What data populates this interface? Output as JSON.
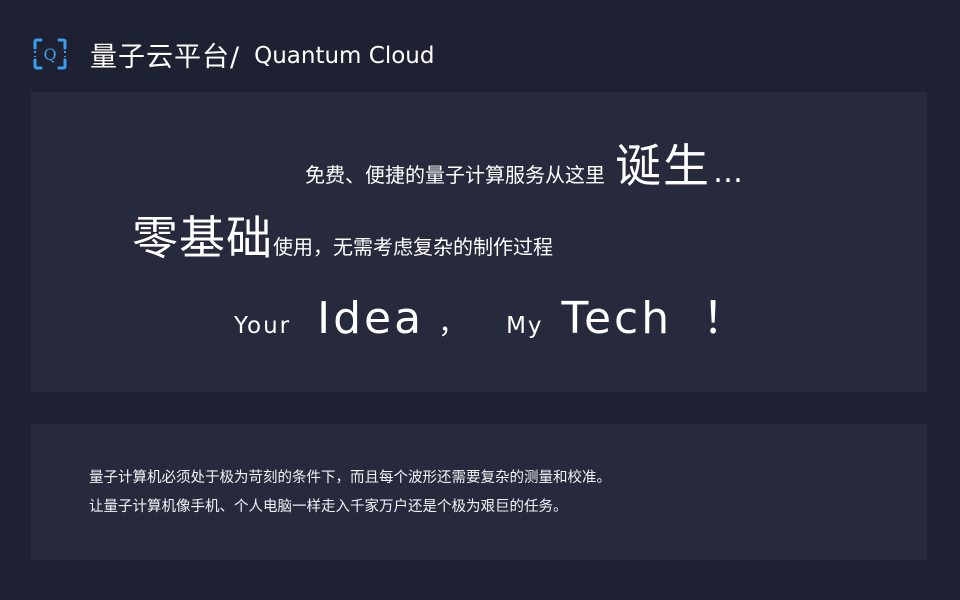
{
  "header": {
    "logo_icon": "quantum-q-bracket-icon",
    "logo_letter": "Q",
    "title_cn": "量子云平台/",
    "title_en": "Quantum Cloud"
  },
  "hero": {
    "line1_text": "免费、便捷的量子计算服务从这里",
    "line1_emphasis": "诞生",
    "line1_ellipsis": "…",
    "line2_emphasis": "零基础",
    "line2_text": "使用，无需考虑复杂的制作过程",
    "slogan": {
      "your": "Your",
      "idea": "Idea",
      "comma": "，",
      "my": "My",
      "tech": "Tech",
      "exclaim": "！"
    }
  },
  "info": {
    "line1": "量子计算机必须处于极为苛刻的条件下，而且每个波形还需要复杂的测量和校准。",
    "line2": "让量子计算机像手机、个人电脑一样走入千家万户还是个极为艰巨的任务。"
  },
  "colors": {
    "background": "#1e2131",
    "panel": "#262a3c",
    "accent": "#3aa0f2",
    "text": "#ffffff"
  }
}
